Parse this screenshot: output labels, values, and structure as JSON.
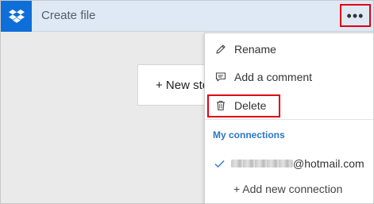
{
  "header": {
    "title": "Create file",
    "more_label": "•••"
  },
  "canvas": {
    "new_step_label": "+ New step"
  },
  "menu": {
    "rename": "Rename",
    "add_comment": "Add a comment",
    "delete": "Delete",
    "connections_title": "My connections",
    "connection_email": "@hotmail.com",
    "add_connection": "+ Add new connection"
  },
  "icons": {
    "logo": "dropbox-icon",
    "rename": "pencil-icon",
    "comment": "comment-icon",
    "delete": "trash-icon",
    "selected": "checkmark-icon"
  },
  "colors": {
    "brand": "#0f6fd8",
    "header_bg": "#dfe9f5",
    "highlight": "#e00012",
    "section_title": "#2b76c8"
  }
}
